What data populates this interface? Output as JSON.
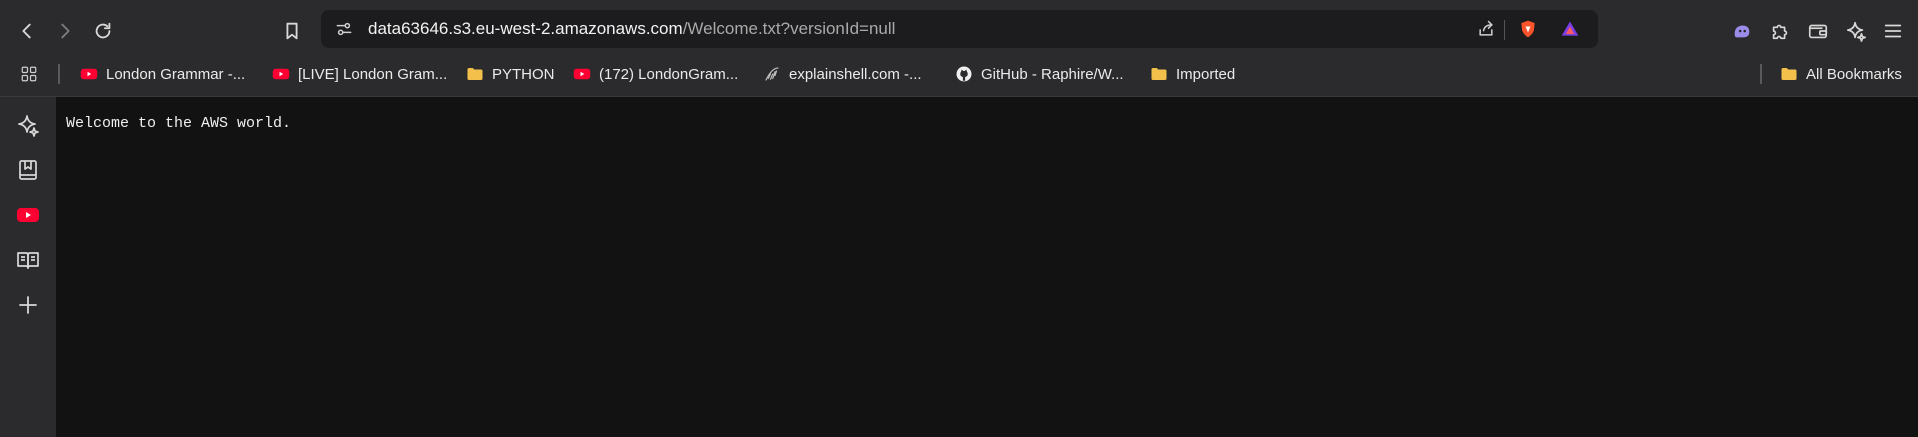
{
  "browser": {
    "address": {
      "host": "data63646.s3.eu-west-2.amazonaws.com",
      "path": "/Welcome.txt?versionId=null"
    },
    "nav_icons": [
      "back-icon",
      "forward-icon",
      "reload-icon",
      "bookmark-icon"
    ],
    "toolbar_icons": [
      "share-icon",
      "brave-shields-icon",
      "brave-rewards-icon",
      "leo-ai-icon",
      "extensions-icon",
      "wallet-icon",
      "sparkle-icon",
      "menu-icon"
    ]
  },
  "bookmarks": {
    "items": [
      {
        "label": "London Grammar -...",
        "icon": "youtube-icon"
      },
      {
        "label": "[LIVE] London Gram...",
        "icon": "youtube-icon"
      },
      {
        "label": "PYTHON",
        "icon": "folder-icon"
      },
      {
        "label": "(172) LondonGram...",
        "icon": "youtube-icon"
      },
      {
        "label": "explainshell.com -...",
        "icon": "shell-icon"
      },
      {
        "label": "GitHub - Raphire/W...",
        "icon": "github-icon"
      },
      {
        "label": "Imported",
        "icon": "folder-icon"
      }
    ],
    "all_bookmarks": "All Bookmarks"
  },
  "sidebar": {
    "icons": [
      "leo-icon",
      "bookmarks-panel-icon",
      "youtube-icon",
      "reading-list-icon",
      "add-icon"
    ]
  },
  "content": {
    "text": "Welcome to the AWS world."
  },
  "colors": {
    "chrome_bg": "#2b2b2d",
    "page_bg": "#121212",
    "youtube_red": "#ff0033",
    "folder_yellow": "#f2c04b",
    "brave_orange": "#fb542b"
  }
}
